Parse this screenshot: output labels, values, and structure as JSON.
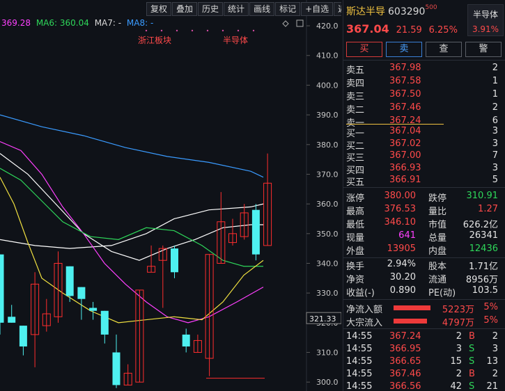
{
  "toolbar": [
    "复权",
    "叠加",
    "历史",
    "统计",
    "画线",
    "标记",
    "+自选",
    "返回"
  ],
  "ma_legend": [
    {
      "label": "369.28",
      "color": "#ff40ff"
    },
    {
      "label": "MA6: 360.04",
      "color": "#2ed75a"
    },
    {
      "label": "MA7: -",
      "color": "#d8d8d8"
    },
    {
      "label": "MA8: -",
      "color": "#3a9bff"
    }
  ],
  "annotations": [
    "浙江板块",
    "半导体"
  ],
  "chart_data": {
    "type": "candlestick",
    "y_ticks": [
      "420.0",
      "410.0",
      "400.0",
      "390.0",
      "380.0",
      "370.0",
      "360.0",
      "350.0",
      "340.0",
      "330.0",
      "320.0",
      "310.0",
      "300.0"
    ],
    "ylim": [
      297,
      424
    ],
    "cursor_price": "321.33",
    "candles": [
      {
        "o": 343,
        "c": 320,
        "h": 343,
        "l": 316
      },
      {
        "o": 322,
        "c": 320,
        "h": 326,
        "l": 320
      },
      {
        "o": 319,
        "c": 312,
        "h": 319,
        "l": 309
      },
      {
        "o": 316,
        "c": 333,
        "h": 337,
        "l": 305
      },
      {
        "o": 319,
        "c": 323,
        "h": 328,
        "l": 317
      },
      {
        "o": 322,
        "c": 340,
        "h": 344,
        "l": 320
      },
      {
        "o": 339,
        "c": 329,
        "h": 339,
        "l": 327
      },
      {
        "o": 332,
        "c": 328,
        "h": 332,
        "l": 321
      },
      {
        "o": 325,
        "c": 324,
        "h": 327,
        "l": 321
      },
      {
        "o": 324,
        "c": 316,
        "h": 324,
        "l": 313
      },
      {
        "o": 310,
        "c": 299,
        "h": 316,
        "l": 298
      },
      {
        "o": 299,
        "c": 303,
        "h": 306,
        "l": 299
      },
      {
        "o": 300,
        "c": 331,
        "h": 331,
        "l": 300
      },
      {
        "o": 337,
        "c": 339,
        "h": 346,
        "l": 337
      },
      {
        "o": 341,
        "c": 345,
        "h": 346,
        "l": 325
      },
      {
        "o": 345,
        "c": 337,
        "h": 346,
        "l": 335
      },
      {
        "o": 316,
        "c": 312,
        "h": 318,
        "l": 310
      },
      {
        "o": 310,
        "c": 314,
        "h": 316,
        "l": 310
      },
      {
        "o": 308,
        "c": 343,
        "h": 343,
        "l": 302
      },
      {
        "o": 340,
        "c": 354,
        "h": 364,
        "l": 340
      },
      {
        "o": 347,
        "c": 350,
        "h": 355,
        "l": 346
      },
      {
        "o": 349,
        "c": 357,
        "h": 360,
        "l": 348
      },
      {
        "o": 358,
        "c": 343,
        "h": 360,
        "l": 341
      },
      {
        "o": 346,
        "c": 367,
        "h": 377,
        "l": 346
      }
    ]
  },
  "quote": {
    "name": "斯达半导",
    "code": "603290",
    "sup": "500",
    "price": "367.04",
    "change": "21.59",
    "pct": "6.25%",
    "sector_name": "半导体",
    "sector_pct": "3.91%"
  },
  "buttons": [
    "买",
    "卖",
    "查",
    "警"
  ],
  "asks": [
    {
      "label": "卖五",
      "price": "367.98",
      "vol": "2"
    },
    {
      "label": "卖四",
      "price": "367.58",
      "vol": "1"
    },
    {
      "label": "卖三",
      "price": "367.50",
      "vol": "1"
    },
    {
      "label": "卖二",
      "price": "367.46",
      "vol": "2"
    },
    {
      "label": "卖一",
      "price": "367.24",
      "vol": "6"
    }
  ],
  "bids": [
    {
      "label": "买一",
      "price": "367.04",
      "vol": "3"
    },
    {
      "label": "买二",
      "price": "367.02",
      "vol": "3"
    },
    {
      "label": "买三",
      "price": "367.00",
      "vol": "7"
    },
    {
      "label": "买四",
      "price": "366.93",
      "vol": "3"
    },
    {
      "label": "买五",
      "price": "366.91",
      "vol": "5"
    }
  ],
  "stats": [
    [
      {
        "l": "涨停",
        "v": "380.00",
        "c": "red"
      },
      {
        "l": "跌停",
        "v": "310.91",
        "c": "green"
      }
    ],
    [
      {
        "l": "最高",
        "v": "376.53",
        "c": "red"
      },
      {
        "l": "量比",
        "v": "1.27",
        "c": "red"
      }
    ],
    [
      {
        "l": "最低",
        "v": "346.10",
        "c": "red"
      },
      {
        "l": "市值",
        "v": "626.2亿",
        "c": "white"
      }
    ],
    [
      {
        "l": "现量",
        "v": "641",
        "c": "mag"
      },
      {
        "l": "总量",
        "v": "26341",
        "c": "white"
      }
    ],
    [
      {
        "l": "外盘",
        "v": "13905",
        "c": "red"
      },
      {
        "l": "内盘",
        "v": "12436",
        "c": "green"
      }
    ]
  ],
  "stats2": [
    [
      {
        "l": "换手",
        "v": "2.94%",
        "c": "white"
      },
      {
        "l": "股本",
        "v": "1.71亿",
        "c": "white"
      }
    ],
    [
      {
        "l": "净资",
        "v": "30.20",
        "c": "white"
      },
      {
        "l": "流通",
        "v": "8956万",
        "c": "white"
      }
    ],
    [
      {
        "l": "收益(-)",
        "v": "0.890",
        "c": "white"
      },
      {
        "l": "PE(动)",
        "v": "103.5",
        "c": "white"
      }
    ]
  ],
  "flows": [
    {
      "label": "净流入额",
      "value": "5223万",
      "pct": "5%",
      "fill": 0.85
    },
    {
      "label": "大宗流入",
      "value": "4797万",
      "pct": "5%",
      "fill": 0.78
    }
  ],
  "ticks": [
    {
      "t": "14:55",
      "p": "367.24",
      "v": "2",
      "d": "B",
      "n": "2"
    },
    {
      "t": "14:55",
      "p": "366.95",
      "v": "3",
      "d": "S",
      "n": "3"
    },
    {
      "t": "14:55",
      "p": "366.65",
      "v": "15",
      "d": "S",
      "n": "13"
    },
    {
      "t": "14:55",
      "p": "367.46",
      "v": "2",
      "d": "B",
      "n": "2"
    },
    {
      "t": "14:55",
      "p": "366.56",
      "v": "42",
      "d": "S",
      "n": "21"
    }
  ]
}
